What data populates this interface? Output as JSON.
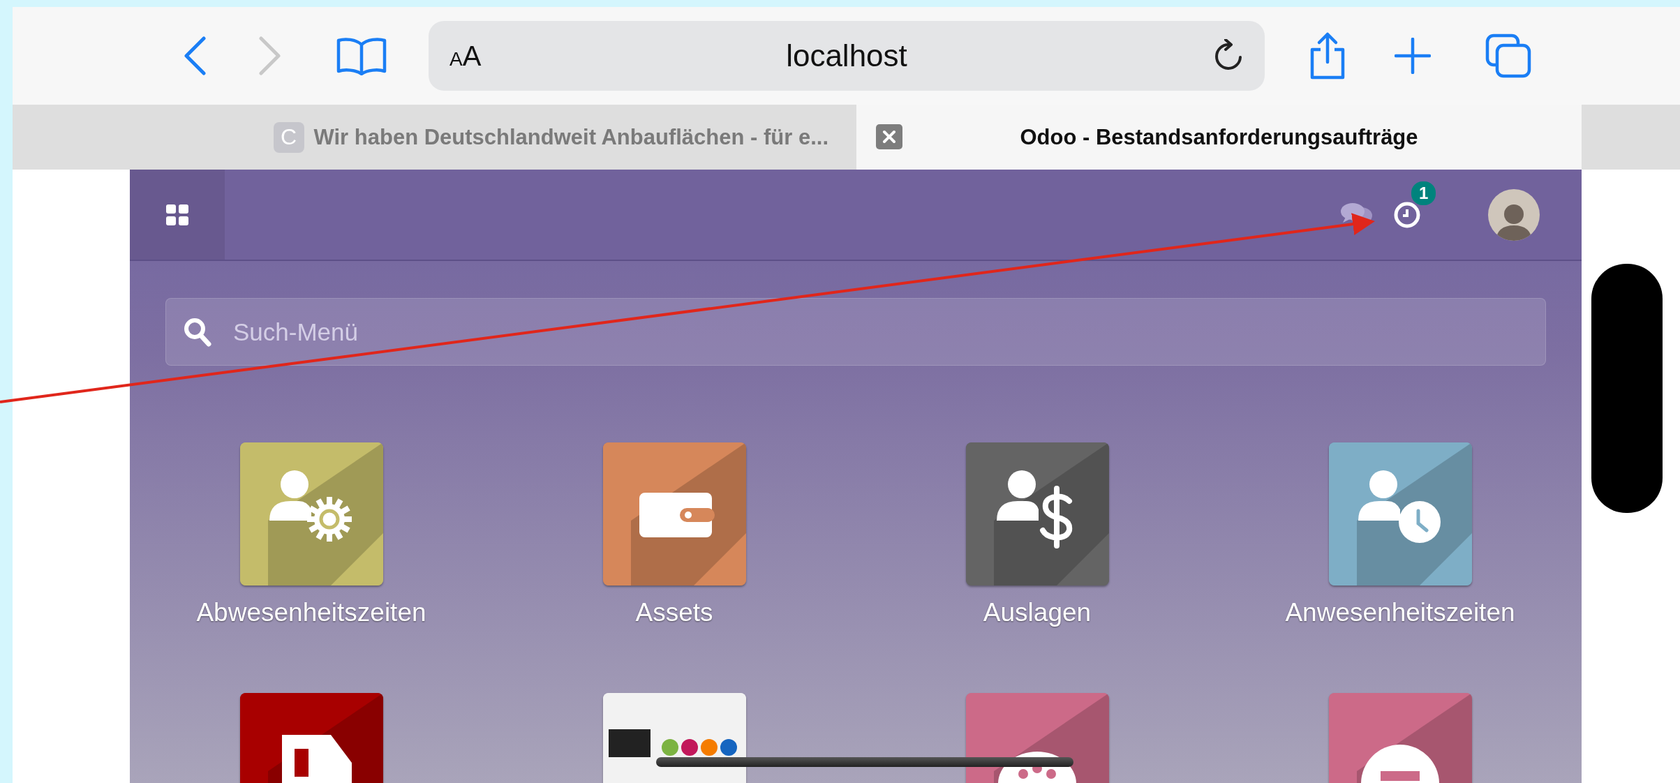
{
  "browser": {
    "text_size_button": "AA",
    "url": "localhost",
    "tabs": [
      {
        "favicon": "C",
        "title": "Wir haben Deutschlandweit Anbauflächen - für e...",
        "selected": false
      },
      {
        "title": "Odoo - Bestandsanforderungsaufträge",
        "selected": true
      }
    ]
  },
  "odoo": {
    "activity_badge": "1",
    "search": {
      "placeholder": "Such-Menü"
    },
    "apps": [
      {
        "label": "Abwesenheitszeiten",
        "kind": "person-gear",
        "color": "#c4bc6a"
      },
      {
        "label": "Assets",
        "kind": "wallet",
        "color": "#d6875a"
      },
      {
        "label": "Auslagen",
        "kind": "person-dollar",
        "color": "#646464"
      },
      {
        "label": "Anwesenheitszeiten",
        "kind": "person-clock",
        "color": "#7eaec6"
      },
      {
        "kind": "document",
        "color": "#a80000"
      },
      {
        "kind": "logo",
        "color": "#f2f2f2"
      },
      {
        "kind": "palette",
        "color": "#cc6a88"
      },
      {
        "kind": "circle",
        "color": "#cc6a88"
      }
    ]
  }
}
